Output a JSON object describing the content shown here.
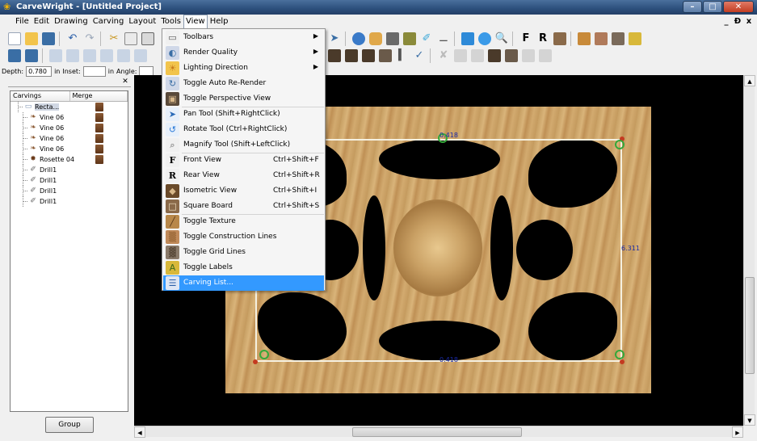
{
  "window": {
    "title": "CarveWright - [Untitled Project]",
    "app_icon": "carvewright-logo-icon",
    "controls": [
      "minimize",
      "maximize",
      "close"
    ]
  },
  "menubar": {
    "items": [
      "File",
      "Edit",
      "Drawing",
      "Carving",
      "Layout",
      "Tools",
      "View",
      "Help"
    ],
    "active": "View",
    "mdi_controls": [
      "_",
      "Ɖ",
      "x"
    ]
  },
  "depth_bar": {
    "depth_label": "Depth:",
    "depth_value": "0.780",
    "depth_unit": "in",
    "inset_label": "Inset:",
    "inset_value": "",
    "inset_unit": "in",
    "angle_label": "Angle:"
  },
  "carving_list": {
    "columns": [
      "Carvings",
      "Merge"
    ],
    "items": [
      {
        "label": "Recta...",
        "icon": "rectangle-board-icon",
        "level": 0,
        "merge": true,
        "selected": true
      },
      {
        "label": "Vine 06",
        "icon": "vine-pattern-icon",
        "level": 1,
        "merge": true
      },
      {
        "label": "Vine 06",
        "icon": "vine-pattern-icon",
        "level": 1,
        "merge": true
      },
      {
        "label": "Vine 06",
        "icon": "vine-pattern-icon",
        "level": 1,
        "merge": true
      },
      {
        "label": "Vine 06",
        "icon": "vine-pattern-icon",
        "level": 1,
        "merge": true
      },
      {
        "label": "Rosette 04",
        "icon": "rosette-pattern-icon",
        "level": 1,
        "merge": true
      },
      {
        "label": "Drill1",
        "icon": "drill-icon",
        "level": 1,
        "merge": false
      },
      {
        "label": "Drill1",
        "icon": "drill-icon",
        "level": 1,
        "merge": false
      },
      {
        "label": "Drill1",
        "icon": "drill-icon",
        "level": 1,
        "merge": false
      },
      {
        "label": "Drill1",
        "icon": "drill-icon",
        "level": 1,
        "merge": false
      }
    ],
    "group_button": "Group"
  },
  "view_menu": {
    "items": [
      {
        "label": "Toolbars",
        "shortcut": "",
        "submenu": true,
        "icon": "toolbars-icon"
      },
      {
        "label": "Render Quality",
        "shortcut": "",
        "submenu": true,
        "icon": "render-quality-icon"
      },
      {
        "label": "Lighting Direction",
        "shortcut": "",
        "submenu": true,
        "icon": "lighting-direction-icon"
      },
      {
        "label": "Toggle Auto Re-Render",
        "shortcut": "",
        "submenu": false,
        "icon": "auto-rerender-icon"
      },
      {
        "label": "Toggle Perspective View",
        "shortcut": "",
        "submenu": false,
        "icon": "perspective-view-icon"
      },
      {
        "label": "Pan Tool (Shift+RightClick)",
        "shortcut": "",
        "submenu": false,
        "icon": "pan-tool-icon"
      },
      {
        "label": "Rotate Tool (Ctrl+RightClick)",
        "shortcut": "",
        "submenu": false,
        "icon": "rotate-tool-icon"
      },
      {
        "label": "Magnify Tool (Shift+LeftClick)",
        "shortcut": "",
        "submenu": false,
        "icon": "magnify-tool-icon"
      },
      {
        "label": "Front View",
        "shortcut": "Ctrl+Shift+F",
        "submenu": false,
        "icon": "front-view-icon"
      },
      {
        "label": "Rear View",
        "shortcut": "Ctrl+Shift+R",
        "submenu": false,
        "icon": "rear-view-icon"
      },
      {
        "label": "Isometric View",
        "shortcut": "Ctrl+Shift+I",
        "submenu": false,
        "icon": "isometric-view-icon"
      },
      {
        "label": "Square Board",
        "shortcut": "Ctrl+Shift+S",
        "submenu": false,
        "icon": "square-board-icon"
      },
      {
        "label": "Toggle Texture",
        "shortcut": "",
        "submenu": false,
        "icon": "toggle-texture-icon"
      },
      {
        "label": "Toggle Construction Lines",
        "shortcut": "",
        "submenu": false,
        "icon": "construction-lines-icon"
      },
      {
        "label": "Toggle Grid Lines",
        "shortcut": "",
        "submenu": false,
        "icon": "grid-lines-icon"
      },
      {
        "label": "Toggle Labels",
        "shortcut": "",
        "submenu": false,
        "icon": "toggle-labels-icon"
      },
      {
        "label": "Carving List...",
        "shortcut": "",
        "submenu": false,
        "icon": "carving-list-icon",
        "highlighted": true
      }
    ]
  },
  "viewport": {
    "dimension_labels": [
      "0.418",
      "6.311",
      "0.418"
    ],
    "colors": {
      "board": "#d2aa6f",
      "background": "#000000",
      "dimension": "#1a2aa8",
      "outline": "#f5f0e0"
    }
  }
}
